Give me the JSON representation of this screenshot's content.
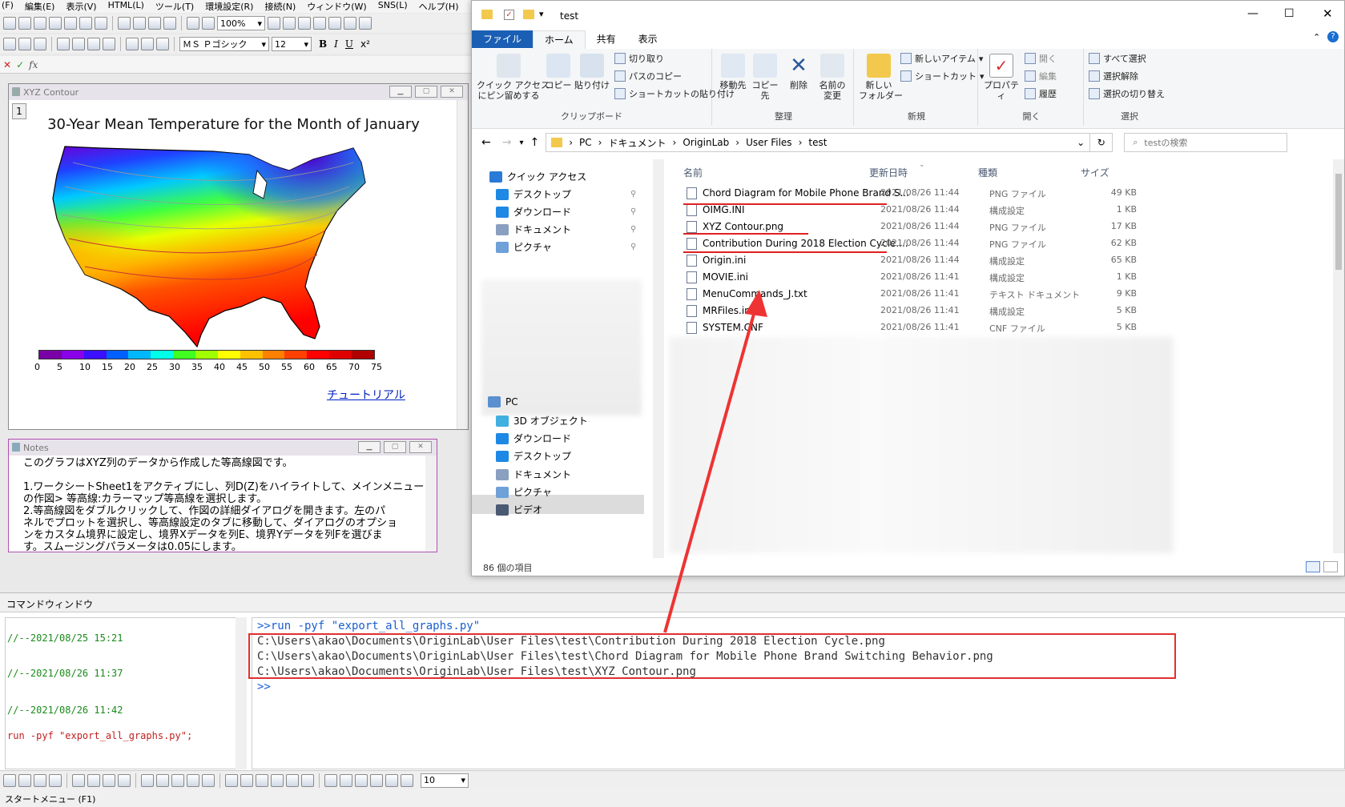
{
  "origin": {
    "menu": [
      "(F)",
      "編集(E)",
      "表示(V)",
      "HTML(L)",
      "ツール(T)",
      "環境設定(R)",
      "接続(N)",
      "ウィンドウ(W)",
      "SNS(L)",
      "ヘルプ(H)"
    ],
    "zoom": "100%",
    "font_name": "ＭＳ Ｐゴシック",
    "font_size": "12",
    "bold": "B",
    "italic": "I",
    "underline": "U",
    "fx_label": "fx"
  },
  "graph_window": {
    "title": "XYZ Contour",
    "layer": "1",
    "chart_title": "30-Year Mean Temperature for the Month of January",
    "tutorial_link": "チュートリアル"
  },
  "chart_data": {
    "type": "heatmap",
    "title": "30-Year Mean Temperature for the Month of January",
    "colorscale_ticks": [
      "0",
      "5",
      "10",
      "15",
      "20",
      "25",
      "30",
      "35",
      "40",
      "45",
      "50",
      "55",
      "60",
      "65",
      "70",
      "75"
    ],
    "colorscale_colors": [
      "#7a00a8",
      "#8a00e8",
      "#3a10ff",
      "#0060ff",
      "#00b8ff",
      "#00ffe8",
      "#40ff20",
      "#a0ff00",
      "#ffff00",
      "#ffc000",
      "#ff8000",
      "#ff4000",
      "#ff0000",
      "#e00000",
      "#b00000"
    ]
  },
  "notes_window": {
    "title": "Notes",
    "lines": [
      "このグラフはXYZ列のデータから作成した等高線図です。",
      "",
      "1.ワークシートSheet1をアクティブにし、列D(Z)をハイライトして、メインメニュー",
      "の作図> 等高線:カラーマップ等高線を選択します。",
      "2.等高線図をダブルクリックして、作図の詳細ダイアログを開きます。左のパ",
      "ネルでプロットを選択し、等高線設定のタブに移動して、ダイアログのオプショ",
      "ンをカスタム境界に設定し、境界Xデータを列E、境界Yデータを列Fを選びま",
      "す。スムージングパラメータは0.05にします。"
    ]
  },
  "explorer": {
    "title": "test",
    "tabs": [
      "ファイル",
      "ホーム",
      "共有",
      "表示"
    ],
    "ribbon": {
      "pin": "クイック アクセス\nにピン留めする",
      "copy": "コピー",
      "paste": "貼り付け",
      "cut": "切り取り",
      "copy_path": "パスのコピー",
      "paste_shortcut": "ショートカットの貼り付け",
      "clipboard": "クリップボード",
      "move_to": "移動先",
      "copy_to": "コピー先",
      "delete": "削除",
      "rename": "名前の\n変更",
      "organize": "整理",
      "new_folder": "新しい\nフォルダー",
      "new_item": "新しいアイテム",
      "shortcut": "ショートカット",
      "new": "新規",
      "properties": "プロパティ",
      "open": "開く",
      "edit": "編集",
      "history": "履歴",
      "open_group": "開く",
      "select_all": "すべて選択",
      "select_none": "選択解除",
      "invert": "選択の切り替え",
      "select_group": "選択"
    },
    "breadcrumb": [
      "PC",
      "ドキュメント",
      "OriginLab",
      "User Files",
      "test"
    ],
    "search_placeholder": "testの検索",
    "nav": [
      "クイック アクセス",
      "デスクトップ",
      "ダウンロード",
      "ドキュメント",
      "ピクチャ",
      "PC",
      "3D オブジェクト",
      "ダウンロード",
      "デスクトップ",
      "ドキュメント",
      "ピクチャ",
      "ビデオ"
    ],
    "columns": [
      "名前",
      "更新日時",
      "種類",
      "サイズ"
    ],
    "files": [
      {
        "name": "Chord Diagram for Mobile Phone Brand S...",
        "date": "2021/08/26 11:44",
        "type": "PNG ファイル",
        "size": "49 KB"
      },
      {
        "name": "OIMG.INI",
        "date": "2021/08/26 11:44",
        "type": "構成設定",
        "size": "1 KB"
      },
      {
        "name": "XYZ Contour.png",
        "date": "2021/08/26 11:44",
        "type": "PNG ファイル",
        "size": "17 KB"
      },
      {
        "name": "Contribution During 2018 Election Cycle....",
        "date": "2021/08/26 11:44",
        "type": "PNG ファイル",
        "size": "62 KB"
      },
      {
        "name": "Origin.ini",
        "date": "2021/08/26 11:44",
        "type": "構成設定",
        "size": "65 KB"
      },
      {
        "name": "MOVIE.ini",
        "date": "2021/08/26 11:41",
        "type": "構成設定",
        "size": "1 KB"
      },
      {
        "name": "MenuCommands_J.txt",
        "date": "2021/08/26 11:41",
        "type": "テキスト ドキュメント",
        "size": "9 KB"
      },
      {
        "name": "MRFiles.ini",
        "date": "2021/08/26 11:41",
        "type": "構成設定",
        "size": "5 KB"
      },
      {
        "name": "SYSTEM.CNF",
        "date": "2021/08/26 11:41",
        "type": "CNF ファイル",
        "size": "5 KB"
      }
    ],
    "status": "86 個の項目"
  },
  "command_window": {
    "title": "コマンドウィンドウ",
    "history": [
      {
        "text": "//--2021/08/25 15:21",
        "kind": "comment"
      },
      {
        "text": "//--2021/08/26 11:37",
        "kind": "comment"
      },
      {
        "text": "//--2021/08/26 11:42",
        "kind": "comment"
      },
      {
        "text": "run -pyf \"export_all_graphs.py\";",
        "kind": "cmd"
      }
    ],
    "prompt_cmd": ">>run -pyf \"export_all_graphs.py\"",
    "output": [
      "C:\\Users\\akao\\Documents\\OriginLab\\User Files\\test\\Contribution During 2018 Election Cycle.png",
      "C:\\Users\\akao\\Documents\\OriginLab\\User Files\\test\\Chord Diagram for Mobile Phone Brand Switching Behavior.png",
      "C:\\Users\\akao\\Documents\\OriginLab\\User Files\\test\\XYZ Contour.png"
    ],
    "prompt": ">>"
  },
  "bottom": {
    "font_size": "10",
    "status": "スタートメニュー (F1)"
  }
}
